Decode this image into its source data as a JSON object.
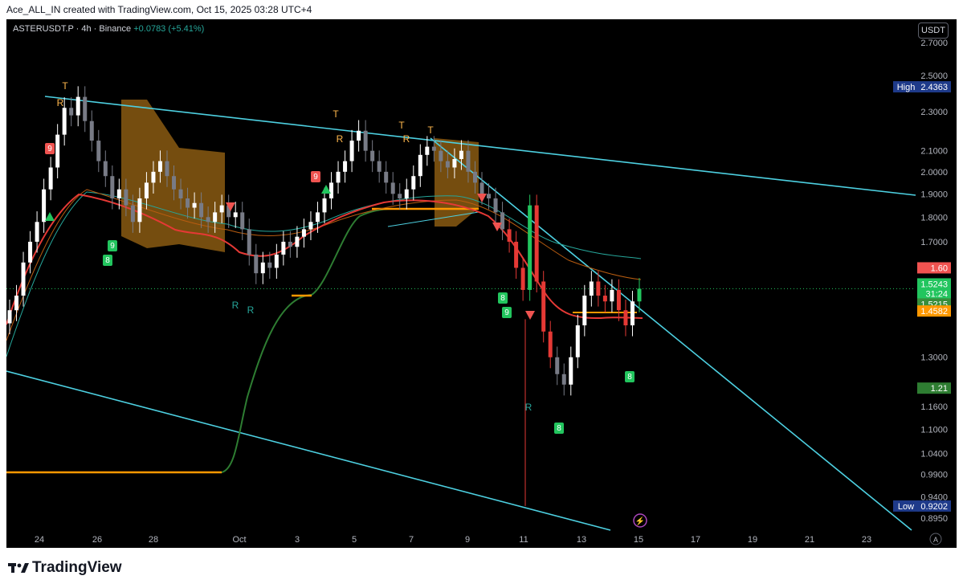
{
  "header": {
    "attribution": "Ace_ALL_IN created with TradingView.com, Oct 15, 2025 03:28 UTC+4"
  },
  "symbol": {
    "name": "ASTERUSDT.P",
    "interval": "4h",
    "exchange": "Binance",
    "separator": " · ",
    "change": "+0.0783 (+5.41%)"
  },
  "currency_button": "USDT",
  "footer": {
    "brand": "TradingView"
  },
  "colors": {
    "background": "#000000",
    "up": "#ffffff",
    "down": "#787b86",
    "trendline": "#4dd0e1",
    "supertrend": "#2e7d32",
    "orange": "#ff9800",
    "red_ma": "#e53935",
    "teal_ma": "#26a69a",
    "cloud": "#8a5a12",
    "green_signal": "#22c55e",
    "red_signal": "#ef5350",
    "label_text": "#ffb74d"
  },
  "chart_data": {
    "type": "candlestick",
    "y_scale": "log",
    "ylim": [
      0.87,
      2.85
    ],
    "y_ticks": [
      "2.7000",
      "2.5000",
      "2.3000",
      "2.1000",
      "2.0000",
      "1.9000",
      "1.8000",
      "1.7000",
      "1.3000",
      "1.1600",
      "1.1000",
      "1.0400",
      "0.9900",
      "0.9400",
      "0.8950"
    ],
    "x_ticks": [
      "24",
      "26",
      "28",
      "Oct",
      "3",
      "5",
      "7",
      "9",
      "11",
      "13",
      "15",
      "17",
      "19",
      "21",
      "23"
    ],
    "price_labels": [
      {
        "prefix": "High",
        "value": "2.4363",
        "color": "#1e3a8a"
      },
      {
        "prefix": "",
        "value": "1.60",
        "color": "#f05350"
      },
      {
        "prefix": "",
        "value": "1.5243",
        "color": "#22c55e"
      },
      {
        "prefix": "",
        "value": "31:24",
        "color": "#22c55e"
      },
      {
        "prefix": "",
        "value": "1.5215",
        "color": "#388e3c"
      },
      {
        "prefix": "",
        "value": "1.4582",
        "color": "#ff9800"
      },
      {
        "prefix": "",
        "value": "1.21",
        "color": "#2e7d32"
      },
      {
        "prefix": "Low",
        "value": "0.9202",
        "color": "#1e3a8a"
      }
    ],
    "current_price": 1.5243,
    "series_close": [
      1.45,
      1.5,
      1.62,
      1.7,
      1.78,
      1.92,
      2.02,
      2.18,
      2.32,
      2.28,
      2.38,
      2.25,
      2.15,
      2.05,
      1.98,
      1.88,
      1.92,
      1.85,
      1.78,
      1.88,
      1.95,
      2.0,
      2.05,
      1.98,
      1.92,
      1.88,
      1.84,
      1.86,
      1.8,
      1.78,
      1.82,
      1.85,
      1.8,
      1.82,
      1.75,
      1.65,
      1.58,
      1.62,
      1.6,
      1.65,
      1.7,
      1.68,
      1.72,
      1.75,
      1.78,
      1.82,
      1.88,
      1.95,
      2.0,
      2.05,
      2.15,
      2.2,
      2.1,
      2.05,
      2.0,
      1.95,
      1.9,
      1.88,
      1.92,
      1.98,
      2.08,
      2.12,
      2.1,
      2.05,
      2.02,
      2.06,
      2.1,
      2.0,
      1.95,
      1.9,
      1.88,
      1.82,
      1.75,
      1.7,
      1.6,
      1.52,
      1.85,
      1.55,
      1.38,
      1.3,
      1.25,
      1.22,
      1.3,
      1.4,
      1.5,
      1.55,
      1.5,
      1.48,
      1.52,
      1.45,
      1.4,
      1.48,
      1.5243
    ],
    "annotations": [
      {
        "text": "T",
        "kind": "T"
      },
      {
        "text": "R",
        "kind": "R"
      },
      {
        "text": "9",
        "kind": "red9"
      },
      {
        "text": "9",
        "kind": "green9"
      },
      {
        "text": "8",
        "kind": "green8"
      },
      {
        "text": "T",
        "kind": "T"
      },
      {
        "text": "R",
        "kind": "R"
      },
      {
        "text": "T",
        "kind": "T"
      },
      {
        "text": "R",
        "kind": "R"
      },
      {
        "text": "T",
        "kind": "T"
      },
      {
        "text": "R",
        "kind": "Rw"
      },
      {
        "text": "R",
        "kind": "Rw"
      },
      {
        "text": "9",
        "kind": "red9"
      },
      {
        "text": "9",
        "kind": "green9"
      },
      {
        "text": "8",
        "kind": "green8"
      },
      {
        "text": "R",
        "kind": "Rw"
      },
      {
        "text": "8",
        "kind": "green8"
      },
      {
        "text": "8",
        "kind": "green8"
      }
    ]
  }
}
